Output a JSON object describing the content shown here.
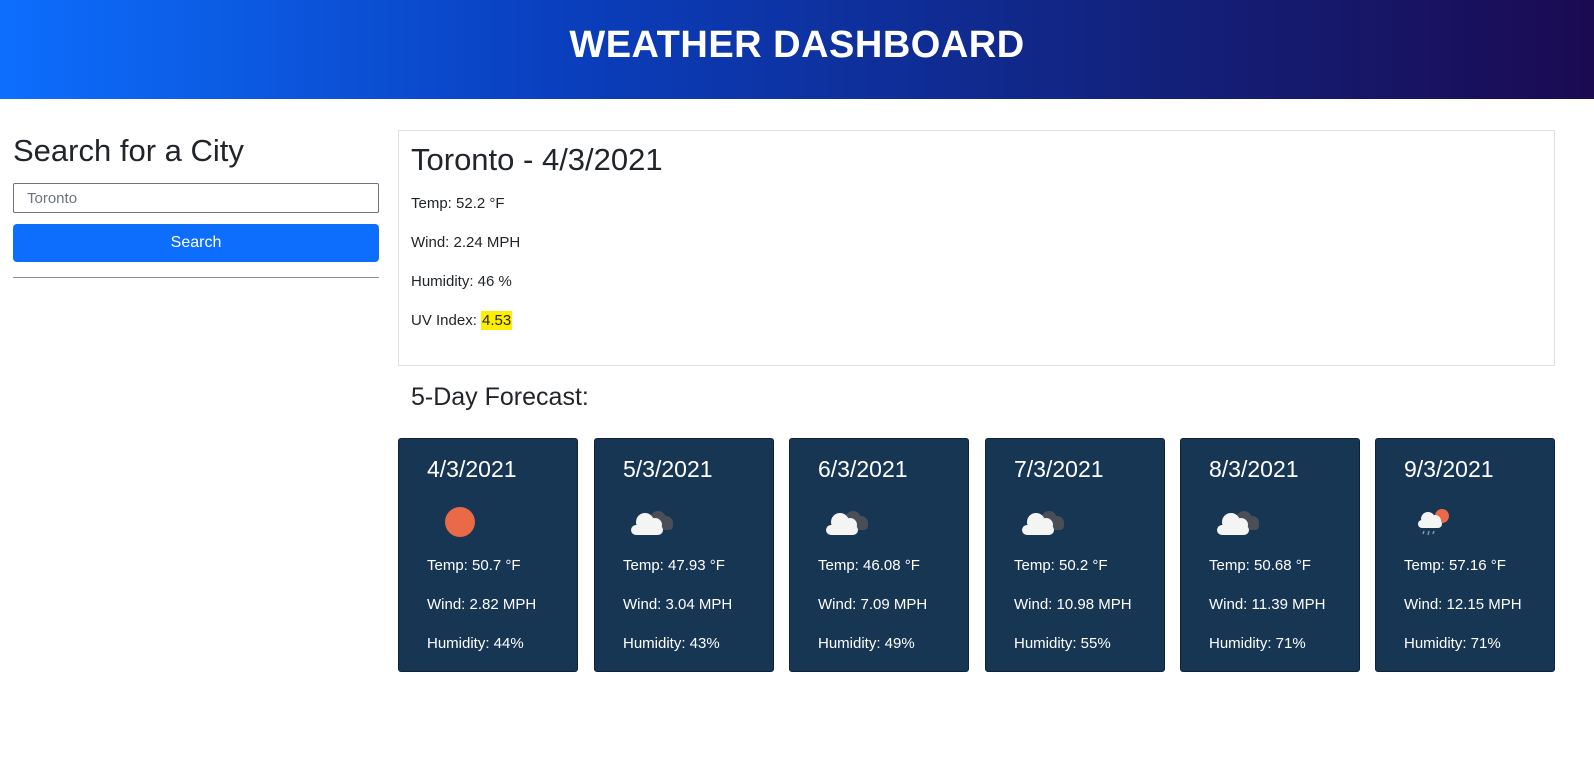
{
  "header": {
    "title": "WEATHER DASHBOARD"
  },
  "sidebar": {
    "heading": "Search for a City",
    "search_value": "Toronto",
    "search_button": "Search"
  },
  "current": {
    "title": "Toronto - 4/3/2021",
    "temp": "Temp: 52.2 °F",
    "wind": "Wind: 2.24 MPH",
    "humidity": "Humidity: 46 %",
    "uv_label": "UV Index: ",
    "uv_value": "4.53",
    "uv_color": "#ffee00"
  },
  "forecast": {
    "title": "5-Day Forecast:",
    "days": [
      {
        "date": "4/3/2021",
        "icon": "sun-icon",
        "temp": "Temp: 50.7 °F",
        "wind": "Wind: 2.82 MPH",
        "humidity": "Humidity: 44%"
      },
      {
        "date": "5/3/2021",
        "icon": "broken-clouds-icon",
        "temp": "Temp: 47.93 °F",
        "wind": "Wind: 3.04 MPH",
        "humidity": "Humidity: 43%"
      },
      {
        "date": "6/3/2021",
        "icon": "broken-clouds-icon",
        "temp": "Temp: 46.08 °F",
        "wind": "Wind: 7.09 MPH",
        "humidity": "Humidity: 49%"
      },
      {
        "date": "7/3/2021",
        "icon": "broken-clouds-icon",
        "temp": "Temp: 50.2 °F",
        "wind": "Wind: 10.98 MPH",
        "humidity": "Humidity: 55%"
      },
      {
        "date": "8/3/2021",
        "icon": "broken-clouds-icon",
        "temp": "Temp: 50.68 °F",
        "wind": "Wind: 11.39 MPH",
        "humidity": "Humidity: 71%"
      },
      {
        "date": "9/3/2021",
        "icon": "rain-icon",
        "temp": "Temp: 57.16 °F",
        "wind": "Wind: 12.15 MPH",
        "humidity": "Humidity: 71%"
      }
    ]
  },
  "colors": {
    "header_gradient_start": "#0d6efd",
    "header_gradient_end": "#1b0a52",
    "card_bg": "#173653",
    "button_bg": "#0d6efd"
  }
}
